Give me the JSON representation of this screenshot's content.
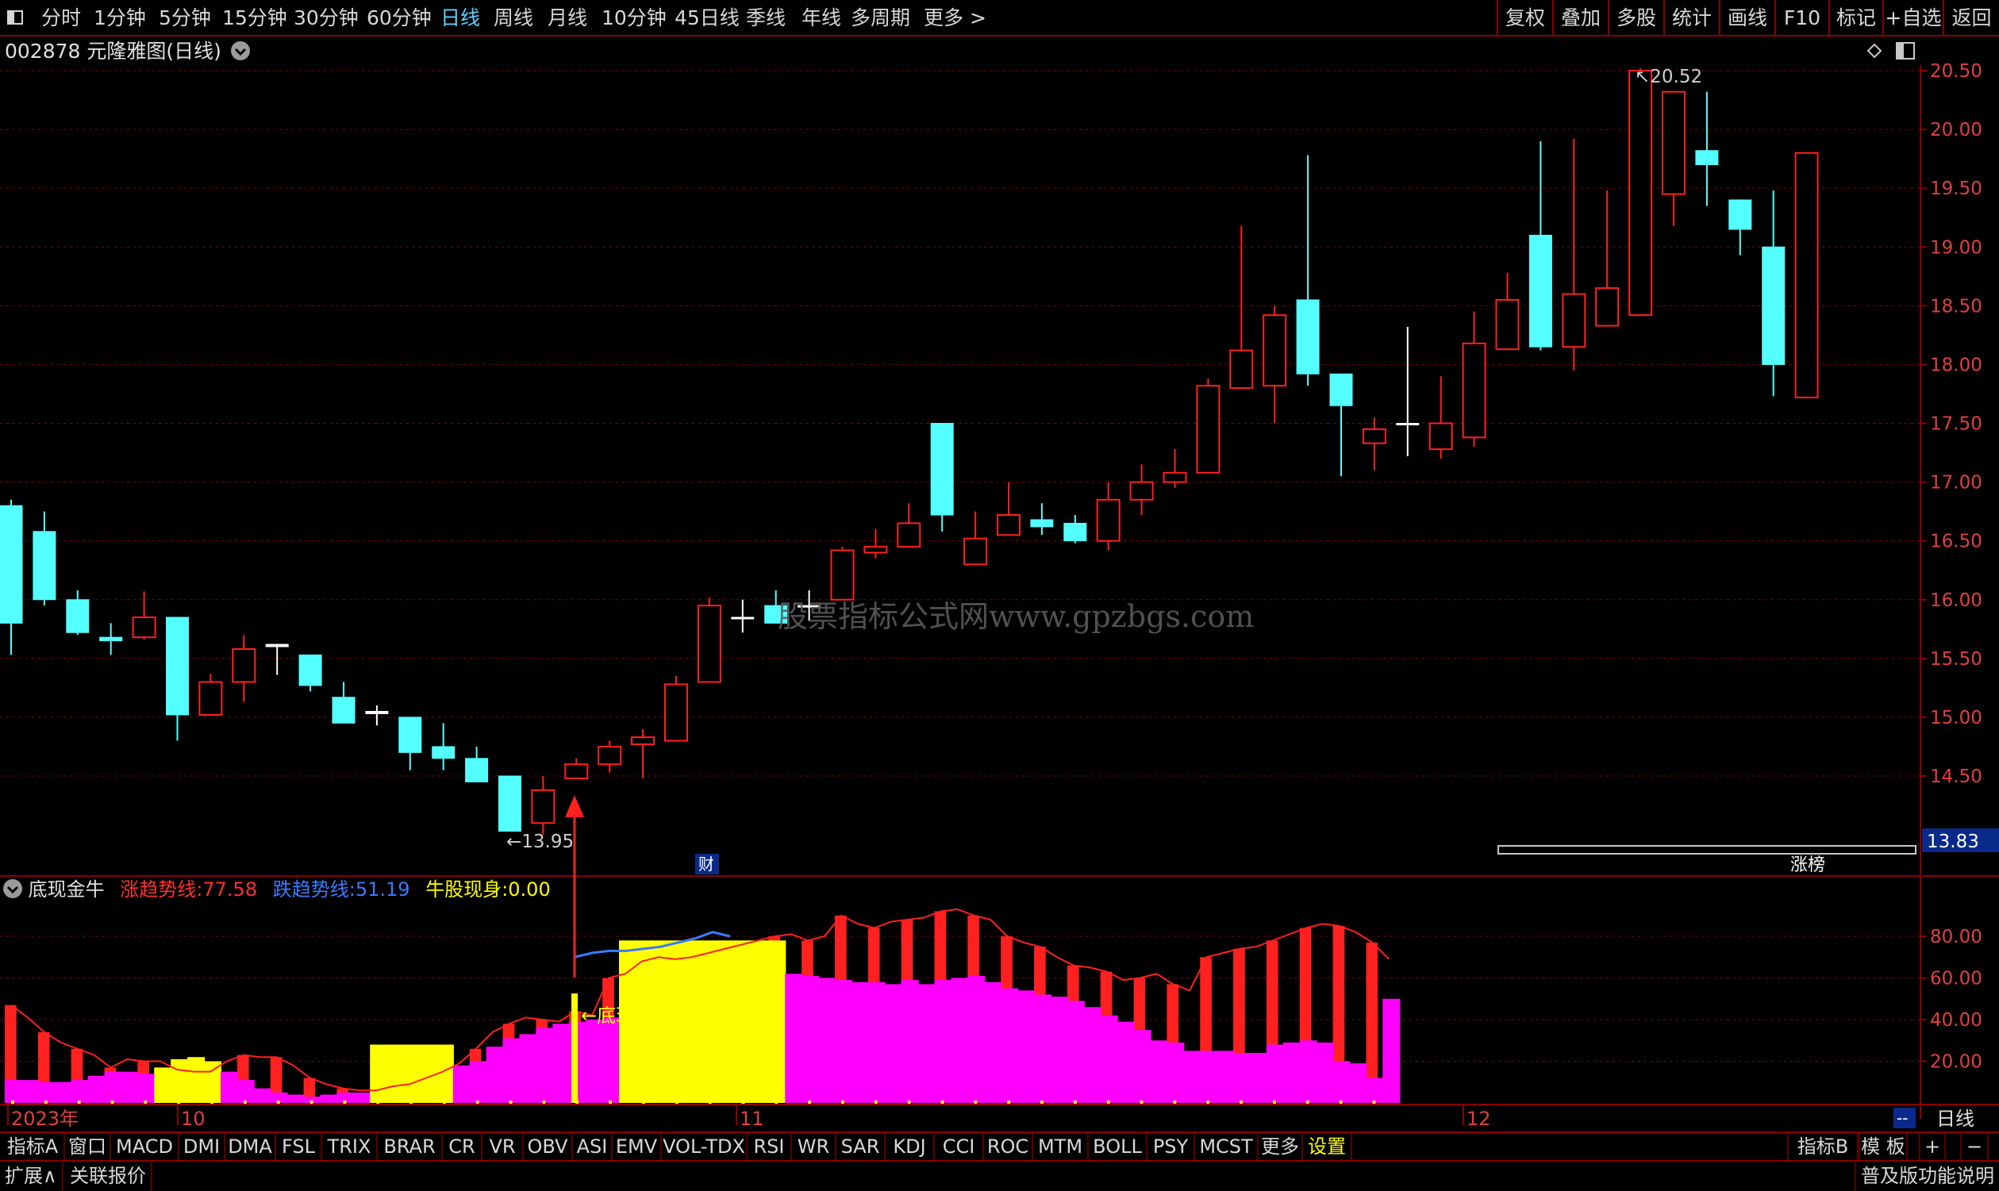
{
  "toolbar": {
    "left_icon": "window-icon",
    "periods": [
      "分时",
      "1分钟",
      "5分钟",
      "15分钟",
      "30分钟",
      "60分钟",
      "日线",
      "周线",
      "月线",
      "10分钟",
      "45日线",
      "季线",
      "年线",
      "多周期",
      "更多 >"
    ],
    "active_period": "日线",
    "right_buttons": [
      "复权",
      "叠加",
      "多股",
      "统计",
      "画线",
      "F10",
      "标记",
      "+自选",
      "返回"
    ]
  },
  "title": {
    "code": "002878",
    "name": "元隆雅图(日线)"
  },
  "price_axis": {
    "labels": [
      "20.50",
      "20.00",
      "19.50",
      "19.00",
      "18.50",
      "18.00",
      "17.50",
      "17.00",
      "16.50",
      "16.00",
      "15.50",
      "15.00",
      "14.50"
    ],
    "current_price": "13.83"
  },
  "annotations": {
    "high": "20.52",
    "low": "13.95",
    "cai_marker": "财",
    "zhang_bang": "涨榜",
    "watermark": "股票指标公式网www.gpzbgs.com",
    "signal": "←底现金牛"
  },
  "indicator": {
    "name": "底现金牛",
    "lines": [
      {
        "label": "涨趋势线:",
        "value": "77.58",
        "color": "#ff3030"
      },
      {
        "label": "跌趋势线:",
        "value": "51.19",
        "color": "#3a7bff"
      },
      {
        "label": "牛股现身:",
        "value": "0.00",
        "color": "#ffff00"
      }
    ],
    "axis_labels": [
      "80.00",
      "60.00",
      "40.00",
      "20.00"
    ]
  },
  "x_axis": {
    "labels": [
      "2023年",
      "10",
      "11",
      "12"
    ]
  },
  "indicator_tabs": [
    "指标A",
    "窗口",
    "MACD",
    "DMI",
    "DMA",
    "FSL",
    "TRIX",
    "BRAR",
    "CR",
    "VR",
    "OBV",
    "ASI",
    "EMV",
    "VOL-TDX",
    "RSI",
    "WR",
    "SAR",
    "KDJ",
    "CCI",
    "ROC",
    "MTM",
    "BOLL",
    "PSY",
    "MCST",
    "更多",
    "设置"
  ],
  "indicator_right": [
    "指标B",
    "模 板",
    "+",
    "−"
  ],
  "period_box": {
    "dash": "--",
    "label": "日线"
  },
  "status": {
    "left": [
      "扩展∧",
      "关联报价"
    ],
    "right": "普及版功能说明"
  },
  "colors": {
    "up": "#ff2020",
    "down": "#54ffff",
    "flat": "#ffffff",
    "grid": "#8a0000",
    "magenta": "#ff00ff",
    "yellow": "#ffff00"
  },
  "chart_data": {
    "type": "candlestick",
    "candles": [
      {
        "o": 16.8,
        "h": 16.85,
        "l": 15.53,
        "c": 15.8
      },
      {
        "o": 16.58,
        "h": 16.75,
        "l": 15.95,
        "c": 16.0
      },
      {
        "o": 16.0,
        "h": 16.08,
        "l": 15.7,
        "c": 15.72
      },
      {
        "o": 15.68,
        "h": 15.8,
        "l": 15.53,
        "c": 15.65
      },
      {
        "o": 15.68,
        "h": 16.07,
        "l": 15.66,
        "c": 15.85
      },
      {
        "o": 15.85,
        "h": 15.85,
        "l": 14.8,
        "c": 15.02
      },
      {
        "o": 15.02,
        "h": 15.37,
        "l": 15.02,
        "c": 15.3
      },
      {
        "o": 15.3,
        "h": 15.7,
        "l": 15.13,
        "c": 15.58
      },
      {
        "o": 15.62,
        "h": 15.62,
        "l": 15.36,
        "c": 15.6
      },
      {
        "o": 15.53,
        "h": 15.53,
        "l": 15.22,
        "c": 15.27
      },
      {
        "o": 15.17,
        "h": 15.3,
        "l": 14.95,
        "c": 14.95
      },
      {
        "o": 15.05,
        "h": 15.1,
        "l": 14.93,
        "c": 15.03
      },
      {
        "o": 15.0,
        "h": 15.0,
        "l": 14.55,
        "c": 14.7
      },
      {
        "o": 14.75,
        "h": 14.95,
        "l": 14.55,
        "c": 14.65
      },
      {
        "o": 14.65,
        "h": 14.75,
        "l": 14.5,
        "c": 14.45
      },
      {
        "o": 14.5,
        "h": 14.5,
        "l": 14.05,
        "c": 14.03
      },
      {
        "o": 14.1,
        "h": 14.5,
        "l": 14.0,
        "c": 14.38
      },
      {
        "o": 14.48,
        "h": 14.65,
        "l": 14.48,
        "c": 14.6
      },
      {
        "o": 14.6,
        "h": 14.8,
        "l": 14.53,
        "c": 14.75
      },
      {
        "o": 14.77,
        "h": 14.9,
        "l": 14.48,
        "c": 14.83
      },
      {
        "o": 14.8,
        "h": 15.35,
        "l": 14.8,
        "c": 15.28
      },
      {
        "o": 15.3,
        "h": 16.02,
        "l": 15.3,
        "c": 15.95
      },
      {
        "o": 15.85,
        "h": 16.0,
        "l": 15.72,
        "c": 15.85
      },
      {
        "o": 15.95,
        "h": 16.08,
        "l": 15.8,
        "c": 15.8
      },
      {
        "o": 15.95,
        "h": 16.08,
        "l": 15.82,
        "c": 15.95
      },
      {
        "o": 16.0,
        "h": 16.45,
        "l": 16.0,
        "c": 16.42
      },
      {
        "o": 16.4,
        "h": 16.6,
        "l": 16.35,
        "c": 16.45
      },
      {
        "o": 16.45,
        "h": 16.82,
        "l": 16.45,
        "c": 16.65
      },
      {
        "o": 17.5,
        "h": 17.5,
        "l": 16.58,
        "c": 16.72
      },
      {
        "o": 16.3,
        "h": 16.75,
        "l": 16.3,
        "c": 16.52
      },
      {
        "o": 16.55,
        "h": 17.0,
        "l": 16.55,
        "c": 16.72
      },
      {
        "o": 16.68,
        "h": 16.82,
        "l": 16.55,
        "c": 16.62
      },
      {
        "o": 16.65,
        "h": 16.72,
        "l": 16.48,
        "c": 16.5
      },
      {
        "o": 16.5,
        "h": 17.0,
        "l": 16.42,
        "c": 16.85
      },
      {
        "o": 16.85,
        "h": 17.15,
        "l": 16.72,
        "c": 17.0
      },
      {
        "o": 17.0,
        "h": 17.28,
        "l": 16.95,
        "c": 17.08
      },
      {
        "o": 17.08,
        "h": 17.88,
        "l": 17.08,
        "c": 17.82
      },
      {
        "o": 17.8,
        "h": 19.18,
        "l": 17.8,
        "c": 18.12
      },
      {
        "o": 17.82,
        "h": 18.5,
        "l": 17.5,
        "c": 18.42
      },
      {
        "o": 18.55,
        "h": 19.78,
        "l": 17.82,
        "c": 17.92
      },
      {
        "o": 17.92,
        "h": 17.92,
        "l": 17.05,
        "c": 17.65
      },
      {
        "o": 17.33,
        "h": 17.55,
        "l": 17.1,
        "c": 17.45
      },
      {
        "o": 17.5,
        "h": 18.32,
        "l": 17.22,
        "c": 17.5
      },
      {
        "o": 17.28,
        "h": 17.9,
        "l": 17.2,
        "c": 17.5
      },
      {
        "o": 17.38,
        "h": 18.45,
        "l": 17.3,
        "c": 18.18
      },
      {
        "o": 18.13,
        "h": 18.78,
        "l": 18.13,
        "c": 18.55
      },
      {
        "o": 19.1,
        "h": 19.9,
        "l": 18.12,
        "c": 18.15
      },
      {
        "o": 18.15,
        "h": 19.92,
        "l": 17.95,
        "c": 18.6
      },
      {
        "o": 18.33,
        "h": 19.48,
        "l": 18.33,
        "c": 18.65
      },
      {
        "o": 18.42,
        "h": 20.52,
        "l": 18.42,
        "c": 20.5
      },
      {
        "o": 19.45,
        "h": 20.32,
        "l": 19.18,
        "c": 20.32
      },
      {
        "o": 19.82,
        "h": 20.32,
        "l": 19.35,
        "c": 19.7
      },
      {
        "o": 19.4,
        "h": 19.4,
        "l": 18.93,
        "c": 19.15
      },
      {
        "o": 19.0,
        "h": 19.48,
        "l": 17.73,
        "c": 18.0
      },
      {
        "o": 17.72,
        "h": 19.8,
        "l": 17.72,
        "c": 19.8
      }
    ],
    "indicator_series": {
      "magenta": [
        11,
        11,
        10,
        10,
        11,
        13,
        15,
        15,
        14,
        17,
        21,
        22,
        20,
        15,
        11,
        7,
        5,
        4,
        3,
        4,
        5,
        5,
        3,
        4,
        8,
        10,
        14,
        18,
        20,
        27,
        31,
        33,
        36,
        38,
        39,
        40,
        41,
        42,
        43,
        41,
        55,
        54,
        59,
        61,
        62,
        61,
        62,
        62,
        61,
        60,
        59,
        58,
        58,
        57,
        59,
        57,
        59,
        60,
        61,
        58,
        55,
        54,
        52,
        51,
        49,
        46,
        42,
        39,
        35,
        30,
        29,
        25,
        25,
        25,
        24,
        24,
        28,
        29,
        30,
        29,
        20,
        19,
        12,
        50
      ],
      "red_hist": [
        47,
        41,
        34,
        29,
        26,
        23,
        17,
        21,
        20,
        20,
        16,
        15,
        15,
        20,
        23,
        22,
        22,
        18,
        12,
        9,
        7,
        6,
        6,
        8,
        9,
        12,
        15,
        19,
        26,
        34,
        38,
        41,
        40,
        39,
        44,
        42,
        60,
        62,
        68,
        70,
        69,
        70,
        72,
        74,
        76,
        78,
        80,
        81,
        78,
        80,
        90,
        86,
        84,
        87,
        88,
        89,
        92,
        93,
        90,
        88,
        80,
        77,
        75,
        70,
        66,
        65,
        63,
        59,
        60,
        62,
        57,
        54,
        70,
        72,
        74,
        75,
        78,
        81,
        84,
        86,
        85,
        82,
        77,
        69
      ]
    }
  }
}
